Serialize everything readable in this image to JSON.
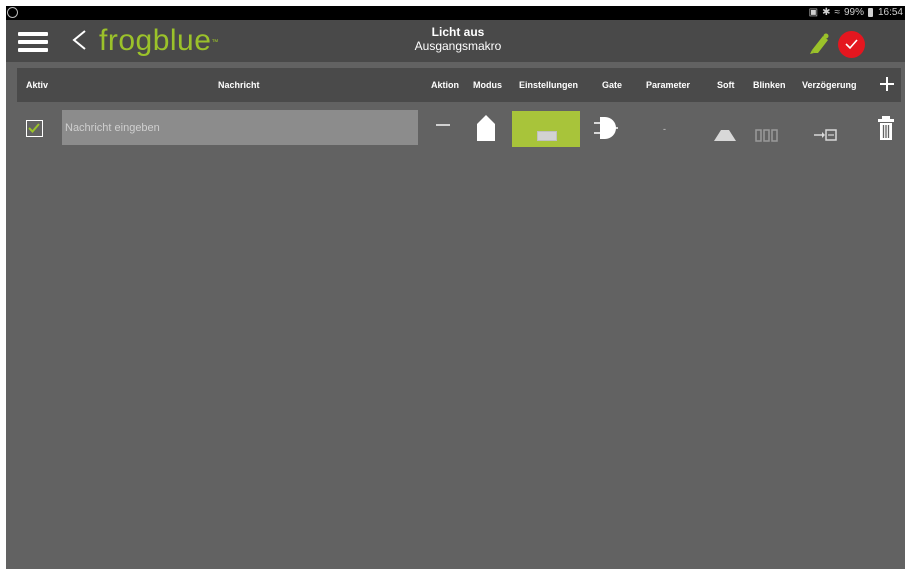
{
  "status": {
    "battery": "99%",
    "time": "16:54"
  },
  "app": {
    "logo": "frogblue",
    "trademark": "™",
    "title": "Licht aus",
    "subtitle": "Ausgangsmakro"
  },
  "columns": [
    {
      "label": "Aktiv"
    },
    {
      "label": "Nachricht"
    },
    {
      "label": "Aktion"
    },
    {
      "label": "Modus"
    },
    {
      "label": "Einstellungen"
    },
    {
      "label": "Gate"
    },
    {
      "label": "Parameter"
    },
    {
      "label": "Soft"
    },
    {
      "label": "Blinken"
    },
    {
      "label": "Verzögerung"
    }
  ],
  "rows": [
    {
      "aktiv": true,
      "nachricht_value": "",
      "nachricht_placeholder": "Nachricht eingeben",
      "parameter": "-"
    }
  ],
  "icons": {
    "menu": "hamburger-icon",
    "back": "chevron-left-icon",
    "edit": "pen-icon",
    "clock": "clock-icon",
    "add": "plus-icon",
    "delete": "trash-icon",
    "modus": "house-icon",
    "gate": "and-gate-icon",
    "soft": "ramp-icon",
    "blinken": "pulse-icon",
    "verzoegerung": "delay-icon"
  },
  "colors": {
    "accent": "#9bc22a",
    "button_active": "#a8c43a",
    "clock": "#e4161f",
    "background": "#626262",
    "header": "#4a4a4a",
    "appbar": "#494949"
  }
}
